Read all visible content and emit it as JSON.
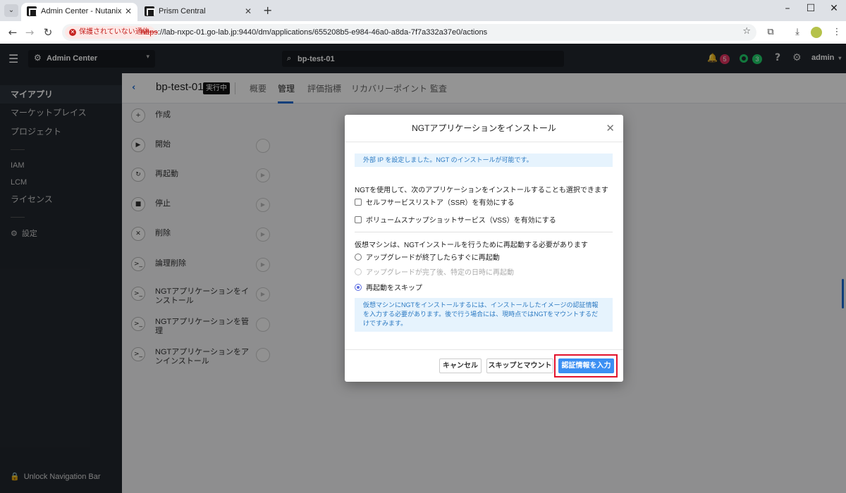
{
  "browser": {
    "tabs": [
      {
        "title": "Admin Center - Nutanix",
        "close": "✕"
      },
      {
        "title": "Prism Central",
        "close": "✕"
      }
    ],
    "new_tab": "+",
    "security_chip": "保護されていない通信",
    "url_scheme": "https",
    "url_rest": "://lab-nxpc-01.go-lab.jp:9440/dm/applications/655208b5-e984-46a0-a8da-7f7a332a37e0/actions",
    "window_controls": [
      "–",
      "☐",
      "✕"
    ]
  },
  "header": {
    "app_switcher": "Admin Center",
    "search_value": "bp-test-01",
    "alerts_count": "5",
    "tasks_count": "3",
    "user": "admin",
    "help": "?"
  },
  "sidebar": {
    "items": [
      "マイアプリ",
      "マーケットプレイス",
      "プロジェクト"
    ],
    "admin_items": [
      "IAM",
      "LCM",
      "ライセンス"
    ],
    "settings": "設定",
    "unlock": "Unlock Navigation Bar"
  },
  "app_bar": {
    "name": "bp-test-01",
    "status": "実行中",
    "tabs": [
      "概要",
      "管理",
      "評価指標",
      "リカバリーポイント",
      "監査"
    ]
  },
  "actions": [
    {
      "label": "作成",
      "icon": "+"
    },
    {
      "label": "開始",
      "icon": "▶"
    },
    {
      "label": "再起動",
      "icon": "↻"
    },
    {
      "label": "停止",
      "icon": "■"
    },
    {
      "label": "削除",
      "icon": "✕"
    },
    {
      "label": "論理削除",
      "icon": ">_"
    },
    {
      "label": "NGTアプリケーションをインストール",
      "icon": ">_"
    },
    {
      "label": "NGTアプリケーションを管理",
      "icon": ">_"
    },
    {
      "label": "NGTアプリケーションをアンインストール",
      "icon": ">_"
    }
  ],
  "modal": {
    "title": "NGTアプリケーションをインストール",
    "info": "外部 IP を設定しました。NGT のインストールが可能です。",
    "options_heading": "NGTを使用して、次のアプリケーションをインストールすることも選択できます",
    "checkbox_ssr": "セルフサービスリストア（SSR）を有効にする",
    "checkbox_vss": "ボリュームスナップショットサービス（VSS）を有効にする",
    "reboot_heading": "仮想マシンは、NGTインストールを行うために再起動する必要があります",
    "radio_now": "アップグレードが終了したらすぐに再起動",
    "radio_scheduled": "アップグレードが完了後、特定の日時に再起動",
    "radio_skip": "再起動をスキップ",
    "note": "仮想マシンにNGTをインストールするには、インストールしたイメージの認証情報を入力する必要があります。後で行う場合には、現時点ではNGTをマウントするだけですみます。",
    "btn_cancel": "キャンセル",
    "btn_skip_mount": "スキップとマウント",
    "btn_enter_credentials": "認証情報を入力"
  }
}
